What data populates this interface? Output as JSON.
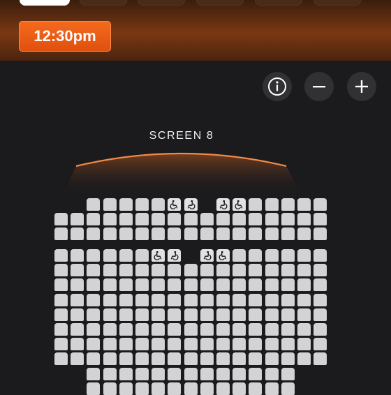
{
  "session": {
    "time_label": "12:30pm"
  },
  "controls": {
    "info_icon": "info-icon",
    "zoom_out_icon": "minus-icon",
    "zoom_in_icon": "plus-icon"
  },
  "screen": {
    "label": "SCREEN 8"
  },
  "colors": {
    "accent": "#f0601a",
    "background": "#1b1b1d",
    "seat": "#d3d3d6",
    "control_bg": "#313134",
    "screen_arc": "#f08a4a"
  },
  "seat_map": {
    "sections": [
      {
        "rows": [
          {
            "seats": [
              "gap",
              "gap",
              "s",
              "s",
              "s",
              "s",
              "s",
              "wc-r",
              "wc-l",
              "gap",
              "wc-l",
              "wc-r",
              "s",
              "s",
              "s",
              "s",
              "s"
            ]
          },
          {
            "seats": [
              "s",
              "s",
              "s",
              "s",
              "s",
              "s",
              "s",
              "s",
              "s",
              "s",
              "s",
              "s",
              "s",
              "s",
              "s",
              "s",
              "s"
            ]
          },
          {
            "seats": [
              "s",
              "s",
              "s",
              "s",
              "s",
              "s",
              "s",
              "s",
              "s",
              "s",
              "s",
              "s",
              "s",
              "s",
              "s",
              "s",
              "s"
            ]
          }
        ]
      },
      {
        "rows": [
          {
            "seats": [
              "s",
              "s",
              "s",
              "s",
              "s",
              "s",
              "wc-r",
              "wc-l",
              "gap",
              "wc-l",
              "wc-r",
              "s",
              "s",
              "s",
              "s",
              "s",
              "s"
            ]
          },
          {
            "seats": [
              "s",
              "s",
              "s",
              "s",
              "s",
              "s",
              "s",
              "s",
              "s",
              "s",
              "s",
              "s",
              "s",
              "s",
              "s",
              "s",
              "s"
            ]
          },
          {
            "seats": [
              "s",
              "s",
              "s",
              "s",
              "s",
              "s",
              "s",
              "s",
              "s",
              "s",
              "s",
              "s",
              "s",
              "s",
              "s",
              "s",
              "s"
            ]
          },
          {
            "seats": [
              "s",
              "s",
              "s",
              "s",
              "s",
              "s",
              "s",
              "s",
              "s",
              "s",
              "s",
              "s",
              "s",
              "s",
              "s",
              "s",
              "s"
            ]
          },
          {
            "seats": [
              "s",
              "s",
              "s",
              "s",
              "s",
              "s",
              "s",
              "s",
              "s",
              "s",
              "s",
              "s",
              "s",
              "s",
              "s",
              "s",
              "s"
            ]
          },
          {
            "seats": [
              "s",
              "s",
              "s",
              "s",
              "s",
              "s",
              "s",
              "s",
              "s",
              "s",
              "s",
              "s",
              "s",
              "s",
              "s",
              "s",
              "s"
            ]
          },
          {
            "seats": [
              "s",
              "s",
              "s",
              "s",
              "s",
              "s",
              "s",
              "s",
              "s",
              "s",
              "s",
              "s",
              "s",
              "s",
              "s",
              "s",
              "s"
            ]
          },
          {
            "seats": [
              "s",
              "s",
              "s",
              "s",
              "s",
              "s",
              "s",
              "s",
              "s",
              "s",
              "s",
              "s",
              "s",
              "s",
              "s",
              "s",
              "s"
            ]
          },
          {
            "seats": [
              "gap",
              "gap",
              "s",
              "s",
              "s",
              "s",
              "s",
              "s",
              "s",
              "s",
              "s",
              "s",
              "s",
              "s",
              "s",
              "gap",
              "gap"
            ]
          },
          {
            "seats": [
              "gap",
              "gap",
              "s",
              "s",
              "s",
              "s",
              "s",
              "s",
              "s",
              "s",
              "s",
              "s",
              "s",
              "s",
              "s",
              "gap",
              "gap"
            ]
          }
        ]
      }
    ]
  }
}
